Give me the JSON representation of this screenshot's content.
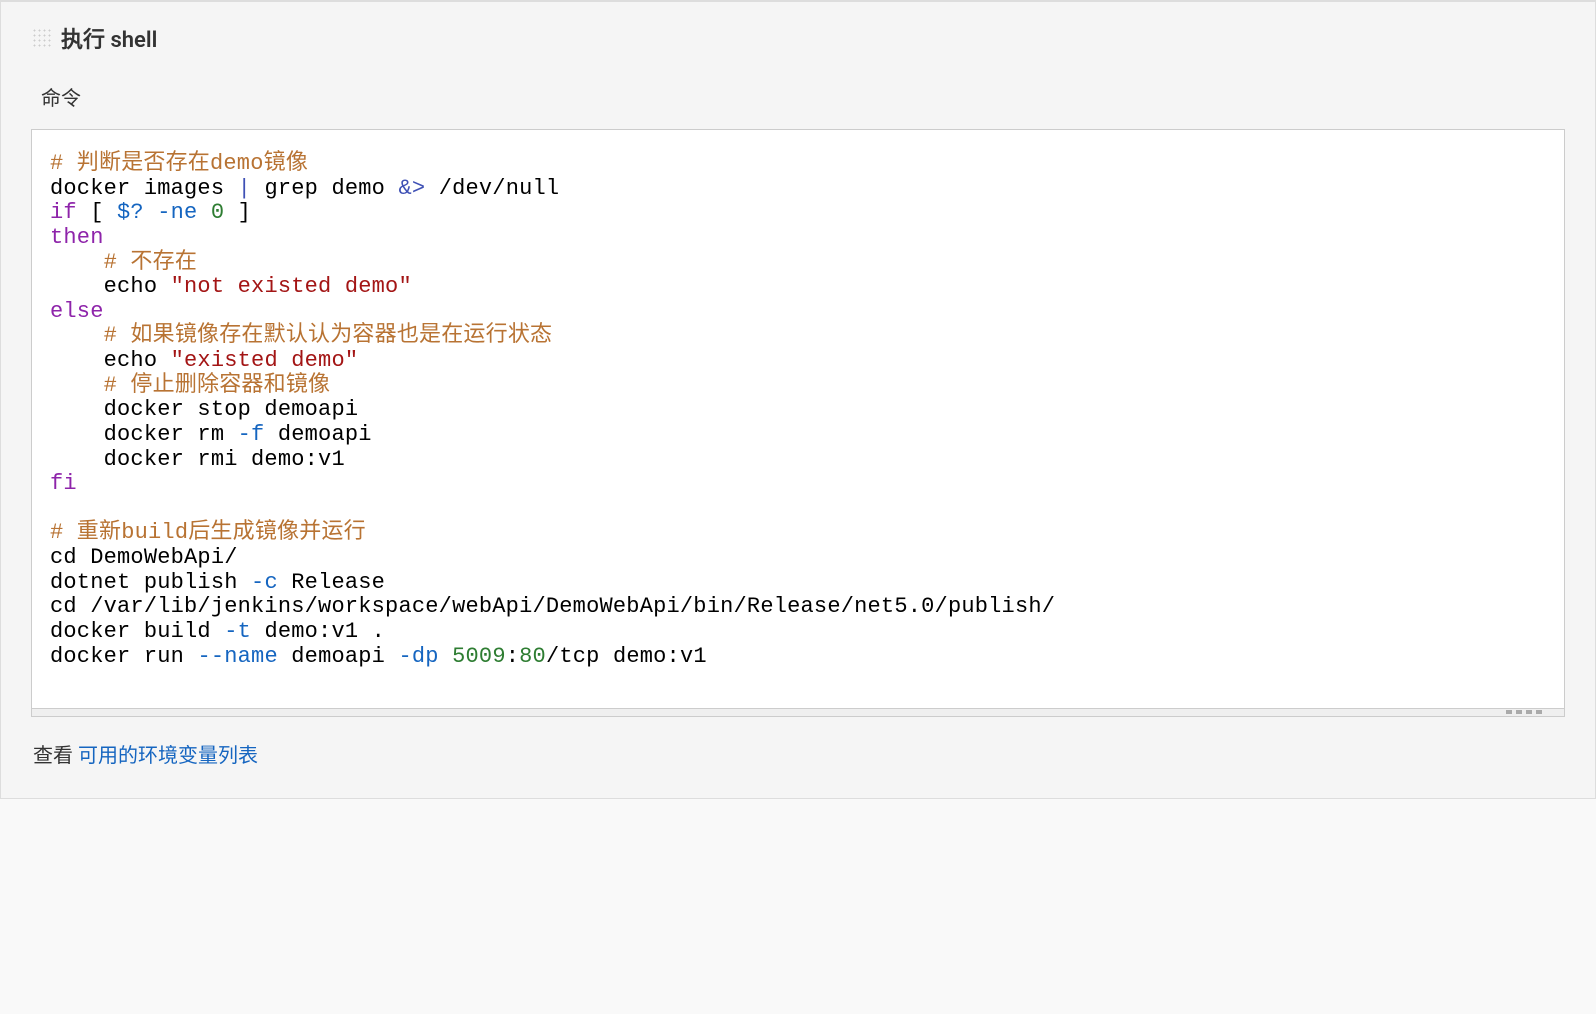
{
  "section": {
    "title": "执行 shell",
    "command_label": "命令"
  },
  "code": {
    "line1_comment": "# 判断是否存在demo镜像",
    "line2_p1": "docker images ",
    "line2_pipe": "|",
    "line2_p2": " grep demo ",
    "line2_redir": "&>",
    "line2_p3": " /dev/null",
    "line3_if": "if",
    "line3_p1": " [ ",
    "line3_var": "$?",
    "line3_p2": " ",
    "line3_flag": "-ne",
    "line3_p3": " ",
    "line3_num": "0",
    "line3_p4": " ]",
    "line4_then": "then",
    "line5_comment": "    # 不存在",
    "line6_p1": "    echo ",
    "line6_str": "\"not existed demo\"",
    "line7_else": "else",
    "line8_comment": "    # 如果镜像存在默认认为容器也是在运行状态",
    "line9_p1": "    echo ",
    "line9_str": "\"existed demo\"",
    "line10_comment": "    # 停止删除容器和镜像",
    "line11": "    docker stop demoapi",
    "line12_p1": "    docker rm ",
    "line12_flag": "-f",
    "line12_p2": " demoapi",
    "line13": "    docker rmi demo:v1",
    "line14_fi": "fi",
    "blank": "",
    "line16_comment": "# 重新build后生成镜像并运行",
    "line17": "cd DemoWebApi/",
    "line18_p1": "dotnet publish ",
    "line18_flag": "-c",
    "line18_p2": " Release",
    "line19": "cd /var/lib/jenkins/workspace/webApi/DemoWebApi/bin/Release/net5.0/publish/",
    "line20_p1": "docker build ",
    "line20_flag": "-t",
    "line20_p2": " demo:v1 .",
    "line21_p1": "docker run ",
    "line21_flag1": "--name",
    "line21_p2": " demoapi ",
    "line21_flag2": "-dp",
    "line21_p3": " ",
    "line21_num1": "5009",
    "line21_colon": ":",
    "line21_num2": "80",
    "line21_p4": "/tcp demo:v1"
  },
  "footer": {
    "prefix": "查看 ",
    "link": "可用的环境变量列表"
  }
}
